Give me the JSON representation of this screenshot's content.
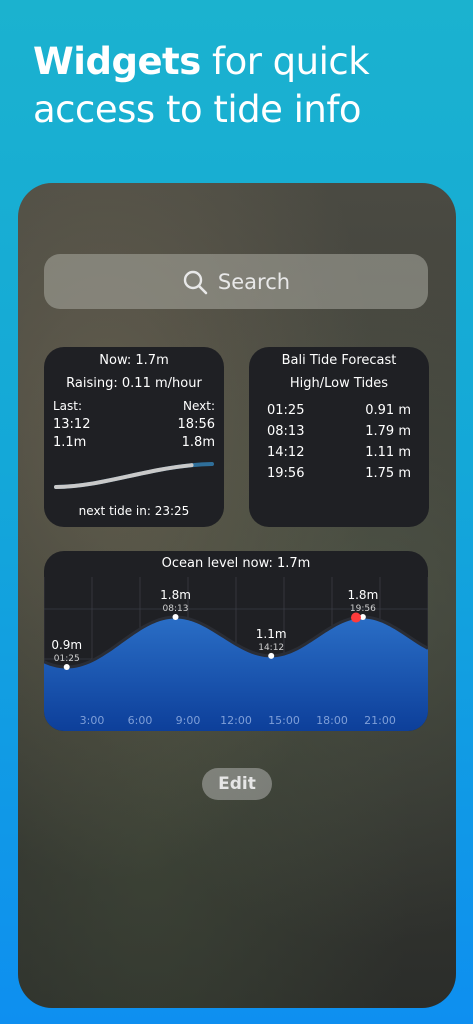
{
  "headline": {
    "bold": "Widgets",
    "rest_line1": " for quick",
    "line2": "access to tide info"
  },
  "search": {
    "placeholder": "Search"
  },
  "now_widget": {
    "now_label": "Now:",
    "now_value": "1.7m",
    "raising_label": "Raising:",
    "raising_value": "0.11 m/hour",
    "last_label": "Last:",
    "next_label": "Next:",
    "last_time": "13:12",
    "next_time": "18:56",
    "last_level": "1.1m",
    "next_level": "1.8m",
    "progress": 0.87,
    "next_tide_label": "next tide in:",
    "next_tide_value": "23:25"
  },
  "forecast_widget": {
    "title": "Bali Tide Forecast",
    "subtitle": "High/Low Tides",
    "rows": [
      {
        "time": "01:25",
        "level": "0.91 m"
      },
      {
        "time": "08:13",
        "level": "1.79 m"
      },
      {
        "time": "14:12",
        "level": "1.11 m"
      },
      {
        "time": "19:56",
        "level": "1.75 m"
      }
    ]
  },
  "ocean_widget": {
    "title": "Ocean level now: 1.7m"
  },
  "chart_data": {
    "type": "area",
    "title": "Ocean level now: 1.7m",
    "xlabel": "",
    "ylabel": "",
    "x_ticks": [
      "3:00",
      "6:00",
      "9:00",
      "12:00",
      "15:00",
      "18:00",
      "21:00"
    ],
    "xlim": [
      0,
      24
    ],
    "extremes": [
      {
        "hour": 1.42,
        "time": "01:25",
        "level": 0.9,
        "label": "0.9m"
      },
      {
        "hour": 8.22,
        "time": "08:13",
        "level": 1.8,
        "label": "1.8m"
      },
      {
        "hour": 14.2,
        "time": "14:12",
        "level": 1.1,
        "label": "1.1m"
      },
      {
        "hour": 19.93,
        "time": "19:56",
        "level": 1.8,
        "label": "1.8m"
      }
    ],
    "current": {
      "hour": 19.5,
      "level": 1.7
    },
    "colors": {
      "fill_top": "#2a6ec6",
      "fill_bottom": "#0d3f9a",
      "line": "#2a2d35",
      "current_dot": "#ff3b3b"
    }
  },
  "edit_button": {
    "label": "Edit"
  }
}
